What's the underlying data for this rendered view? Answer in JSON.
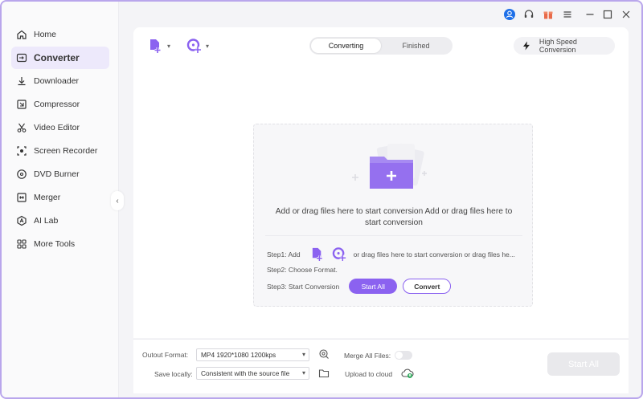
{
  "sidebar": {
    "items": [
      {
        "label": "Home",
        "icon": "home-icon"
      },
      {
        "label": "Converter",
        "icon": "converter-icon",
        "active": true
      },
      {
        "label": "Downloader",
        "icon": "download-icon"
      },
      {
        "label": "Compressor",
        "icon": "compress-icon"
      },
      {
        "label": "Video Editor",
        "icon": "scissors-icon"
      },
      {
        "label": "Screen Recorder",
        "icon": "record-icon"
      },
      {
        "label": "DVD Burner",
        "icon": "disc-icon"
      },
      {
        "label": "Merger",
        "icon": "merge-icon"
      },
      {
        "label": "AI Lab",
        "icon": "ai-icon"
      },
      {
        "label": "More Tools",
        "icon": "grid-icon"
      }
    ],
    "collapse_glyph": "‹"
  },
  "toolbar": {
    "tabs": [
      {
        "label": "Converting",
        "active": true
      },
      {
        "label": "Finished",
        "active": false
      }
    ],
    "high_speed_label": "High Speed Conversion"
  },
  "drop_zone": {
    "text": "Add or drag files here to start conversion Add or drag files here to start conversion",
    "step1_label": "Step1:  Add",
    "step1_after": "or drag files here to start conversion or drag files he...",
    "step2_label": "Step2: Choose Format.",
    "step3_label": "Step3: Start Conversion",
    "start_all_label": "Start All",
    "convert_label": "Convert"
  },
  "bottom": {
    "output_format_label": "Outout Format:",
    "output_format_value": "MP4 1920*1080 1200kps",
    "save_locally_label": "Save locally:",
    "save_locally_value": "Consistent with the source file",
    "merge_label": "Merge All Files:",
    "upload_label": "Upload to cloud",
    "start_all_label": "Start All"
  },
  "colors": {
    "accent": "#8b62f0",
    "active_nav_bg": "#ede9fb",
    "user_avatar": "#1e6fe8",
    "gift": "#e86a4a"
  }
}
